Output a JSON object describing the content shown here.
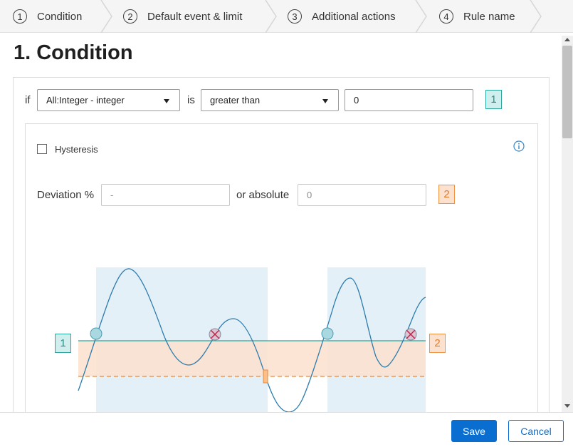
{
  "stepper": {
    "steps": [
      {
        "number": "1",
        "label": "Condition"
      },
      {
        "number": "2",
        "label": "Default event & limit"
      },
      {
        "number": "3",
        "label": "Additional actions"
      },
      {
        "number": "4",
        "label": "Rule name"
      }
    ]
  },
  "page": {
    "title": "1. Condition"
  },
  "condition": {
    "if_label": "if",
    "variable_select": "All:Integer - integer",
    "is_label": "is",
    "operator_select": "greater than",
    "value_input": "0",
    "value_badge": "1"
  },
  "hysteresis": {
    "checkbox_label": "Hysteresis",
    "checked": false,
    "deviation_label": "Deviation %",
    "deviation_placeholder": "-",
    "or_absolute_label": "or absolute",
    "absolute_placeholder": "0",
    "absolute_badge": "2"
  },
  "diagram": {
    "limit_badge": "1",
    "hysteresis_badge": "2",
    "colors": {
      "active_region": "#e4f0f8",
      "band": "#fde1cf",
      "limit_line": "#2aa59c",
      "curve": "#2b7cad",
      "cross": "#c0204a"
    }
  },
  "footer": {
    "save_label": "Save",
    "cancel_label": "Cancel"
  }
}
